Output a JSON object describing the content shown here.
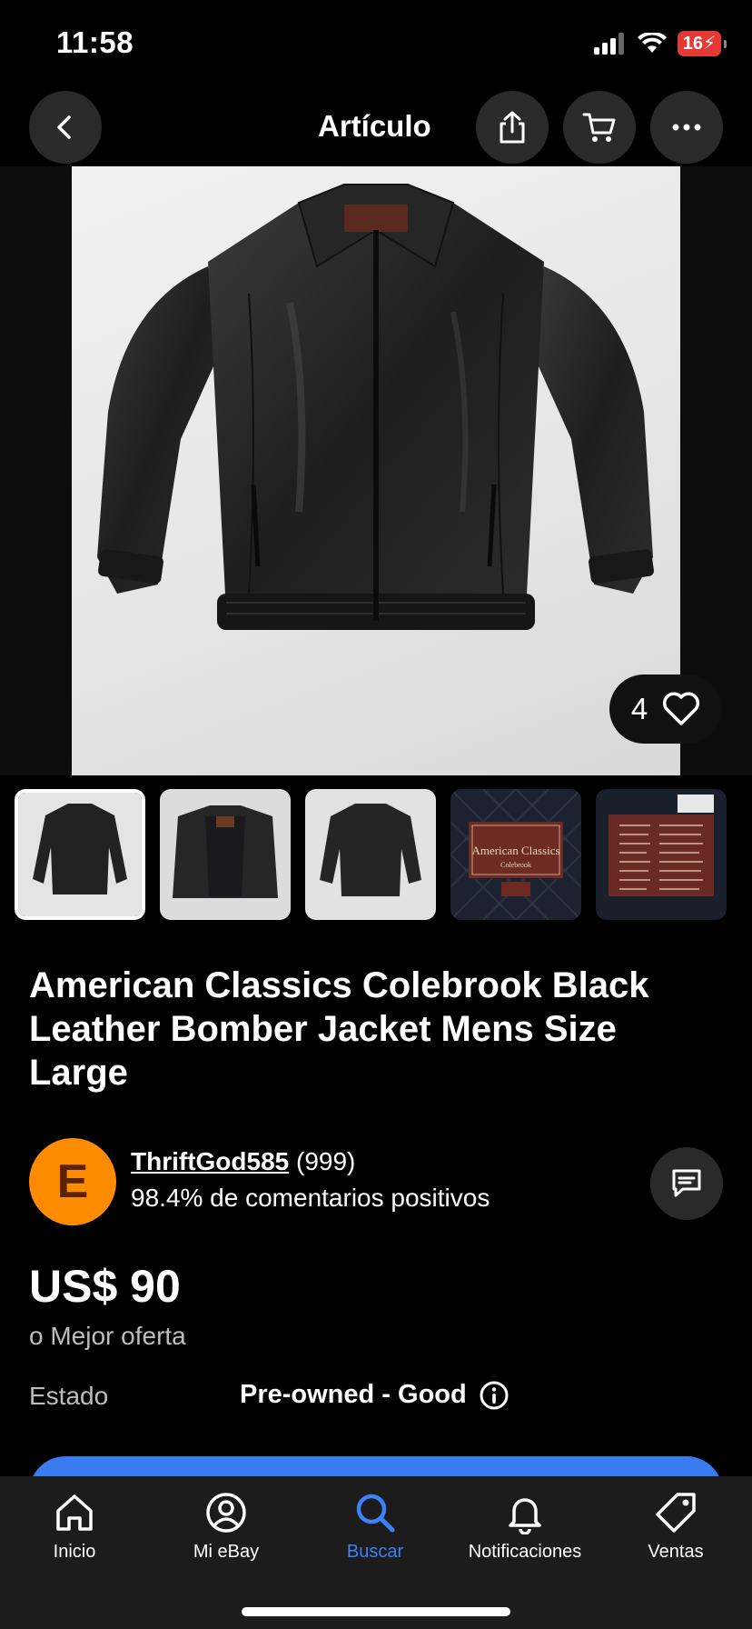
{
  "status_bar": {
    "time": "11:58",
    "battery": "16"
  },
  "header": {
    "title": "Artículo"
  },
  "gallery": {
    "favorite_count": "4"
  },
  "thumbs_overlay": {
    "label_brand": "American Classics",
    "label_sub": "Colebrook"
  },
  "item": {
    "title": "American Classics Colebrook Black Leather Bomber Jacket Mens Size Large"
  },
  "seller": {
    "initial": "E",
    "name": "ThriftGod585",
    "score": "(999)",
    "feedback": "98.4% de comentarios positivos"
  },
  "pricing": {
    "price": "US$ 90",
    "best_offer": "o Mejor oferta"
  },
  "condition": {
    "label": "Estado",
    "value": "Pre-owned - Good"
  },
  "tabs": [
    {
      "label": "Inicio",
      "icon": "home-icon"
    },
    {
      "label": "Mi eBay",
      "icon": "account-icon"
    },
    {
      "label": "Buscar",
      "icon": "search-icon",
      "active": true
    },
    {
      "label": "Notificaciones",
      "icon": "bell-icon"
    },
    {
      "label": "Ventas",
      "icon": "tag-icon"
    }
  ],
  "colors": {
    "accent": "#3b82f6",
    "avatar": "#ff8c00",
    "cta": "#3a7bf0"
  }
}
